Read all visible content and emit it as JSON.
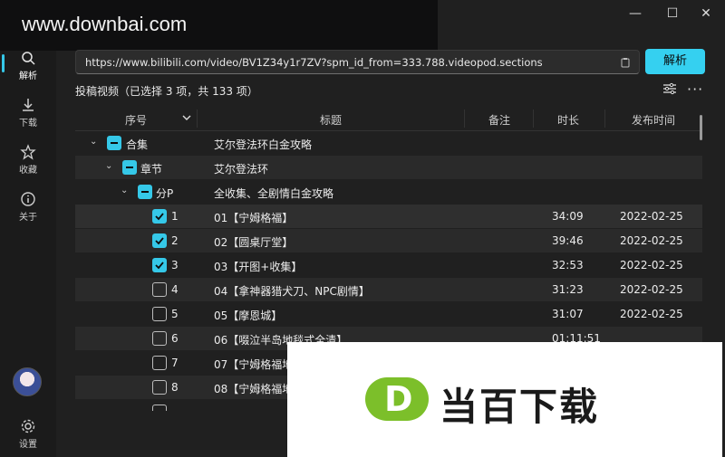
{
  "watermark": "www.downbai.com",
  "sidebar": {
    "items": [
      {
        "label": "解析",
        "icon": "search-icon"
      },
      {
        "label": "下载",
        "icon": "download-icon"
      },
      {
        "label": "收藏",
        "icon": "star-icon"
      },
      {
        "label": "关于",
        "icon": "info-icon"
      }
    ],
    "settings_label": "设置"
  },
  "window": {
    "minimize": "—",
    "maximize": "☐",
    "close": "✕"
  },
  "url": "https://www.bilibili.com/video/BV1Z34y1r7ZV?spm_id_from=333.788.videopod.sections",
  "parse_label": "解析",
  "summary": "投稿视频（已选择 3 项，共 133 项）",
  "columns": {
    "index": "序号",
    "title": "标题",
    "note": "备注",
    "duration": "时长",
    "date": "发布时间"
  },
  "groups": [
    {
      "label": "合集",
      "title": "艾尔登法环白金攻略"
    },
    {
      "label": "章节",
      "title": "艾尔登法环"
    },
    {
      "label": "分P",
      "title": "全收集、全剧情白金攻略"
    }
  ],
  "rows": [
    {
      "num": "1",
      "title": "01【宁姆格福】",
      "duration": "34:09",
      "date": "2022-02-25",
      "checked": true
    },
    {
      "num": "2",
      "title": "02【圆桌厅堂】",
      "duration": "39:46",
      "date": "2022-02-25",
      "checked": true
    },
    {
      "num": "3",
      "title": "03【开图+收集】",
      "duration": "32:53",
      "date": "2022-02-25",
      "checked": true
    },
    {
      "num": "4",
      "title": "04【拿神器猎犬刀、NPC剧情】",
      "duration": "31:23",
      "date": "2022-02-25",
      "checked": false
    },
    {
      "num": "5",
      "title": "05【摩恩城】",
      "duration": "31:07",
      "date": "2022-02-25",
      "checked": false
    },
    {
      "num": "6",
      "title": "06【啜泣半岛地毯式全清】",
      "duration": "01:11:51",
      "date": "",
      "checked": false
    },
    {
      "num": "7",
      "title": "07【宁姆格福地",
      "duration": "",
      "date": "",
      "checked": false
    },
    {
      "num": "8",
      "title": "08【宁姆格福地",
      "duration": "",
      "date": "",
      "checked": false
    }
  ],
  "logo": {
    "mark": "D",
    "text": "当百下载"
  },
  "colors": {
    "accent": "#35c8e8",
    "logo_green": "#7cbf2a"
  }
}
